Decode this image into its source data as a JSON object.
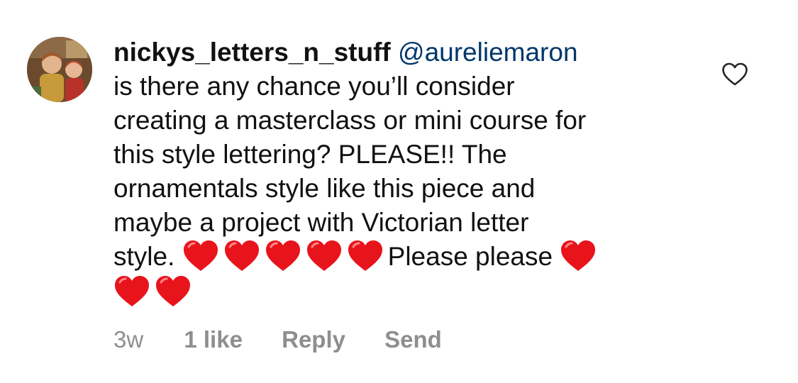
{
  "comment": {
    "username": "nickys_letters_n_stuff",
    "mention": "@aureliemaron",
    "text_lines": [
      "is there any chance you’ll consider",
      "creating a masterclass or mini course for",
      "this style lettering? PLEASE!! The",
      "ornamentals style like this piece and",
      "maybe a project with Victorian letter"
    ],
    "last_line_start": "style.",
    "last_line_middle": "Please please",
    "emoji": "red-heart-icon",
    "meta": {
      "time": "3w",
      "likes": "1 like",
      "reply": "Reply",
      "send": "Send"
    }
  },
  "colors": {
    "text": "#111111",
    "mention": "#00376b",
    "meta": "#8e8e8e",
    "heart": "#e8141b"
  },
  "icons": {
    "like": "heart-outline-icon",
    "avatar": "profile-avatar"
  }
}
